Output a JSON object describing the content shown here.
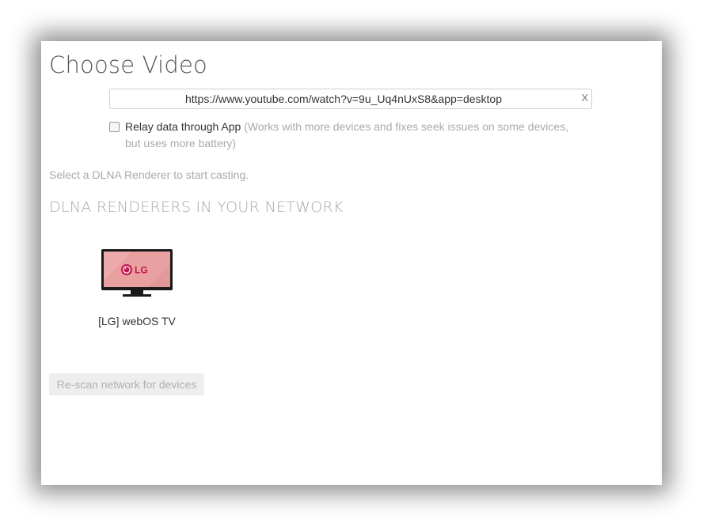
{
  "dialog": {
    "title": "Choose Video"
  },
  "url": {
    "value": "https://www.youtube.com/watch?v=9u_Uq4nUxS8&app=desktop",
    "clear_label": "X"
  },
  "relay": {
    "label": "Relay data through App",
    "note": "(Works with more devices and fixes seek issues on some devices, but uses more battery)",
    "checked": false
  },
  "hint": "Select a DLNA Renderer to start casting.",
  "renderers": {
    "heading": "DLNA RENDERERS IN YOUR NETWORK",
    "items": [
      {
        "name": "[LG] webOS TV",
        "logo_text": "LG",
        "icon": "tv-icon",
        "screen_color": "#e8a0a0"
      }
    ]
  },
  "rescan_label": "Re-scan network for devices",
  "colors": {
    "lg_brand": "#c6164d",
    "muted_text": "#aaaaaa"
  }
}
